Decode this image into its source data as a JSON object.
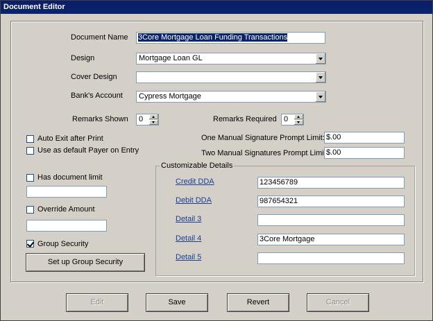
{
  "window": {
    "title": "Document Editor"
  },
  "form": {
    "document_name_label": "Document Name",
    "document_name_value": "3Core Mortgage Loan Funding Transactions",
    "design_label": "Design",
    "design_value": "Mortgage Loan GL",
    "cover_design_label": "Cover Design",
    "cover_design_value": "",
    "banks_account_label": "Bank's Account",
    "banks_account_value": "Cypress Mortgage",
    "remarks_shown_label": "Remarks Shown",
    "remarks_shown_value": "0",
    "remarks_required_label": "Remarks Required",
    "remarks_required_value": "0",
    "one_sig_label": "One Manual Signature Prompt Limit:",
    "one_sig_value": "$.00",
    "two_sig_label": "Two Manual Signatures Prompt Limit:",
    "two_sig_value": "$.00"
  },
  "options": {
    "auto_exit_label": "Auto Exit after Print",
    "auto_exit_checked": false,
    "default_payer_label": "Use as default Payer on Entry",
    "default_payer_checked": false,
    "has_doc_limit_label": "Has document limit",
    "has_doc_limit_checked": false,
    "doc_limit_value": "",
    "override_amount_label": "Override Amount",
    "override_amount_checked": false,
    "override_amount_value": "",
    "group_security_label": "Group Security",
    "group_security_checked": true,
    "setup_group_security_label": "Set up Group Security"
  },
  "customizable": {
    "title": "Customizable Details",
    "rows": [
      {
        "label": "Credit DDA",
        "value": "123456789"
      },
      {
        "label": "Debit DDA",
        "value": "987654321"
      },
      {
        "label": "Detail 3",
        "value": ""
      },
      {
        "label": "Detail 4",
        "value": "3Core Mortgage"
      },
      {
        "label": "Detail 5",
        "value": ""
      }
    ]
  },
  "buttons": {
    "edit": "Edit",
    "save": "Save",
    "revert": "Revert",
    "cancel": "Cancel"
  }
}
